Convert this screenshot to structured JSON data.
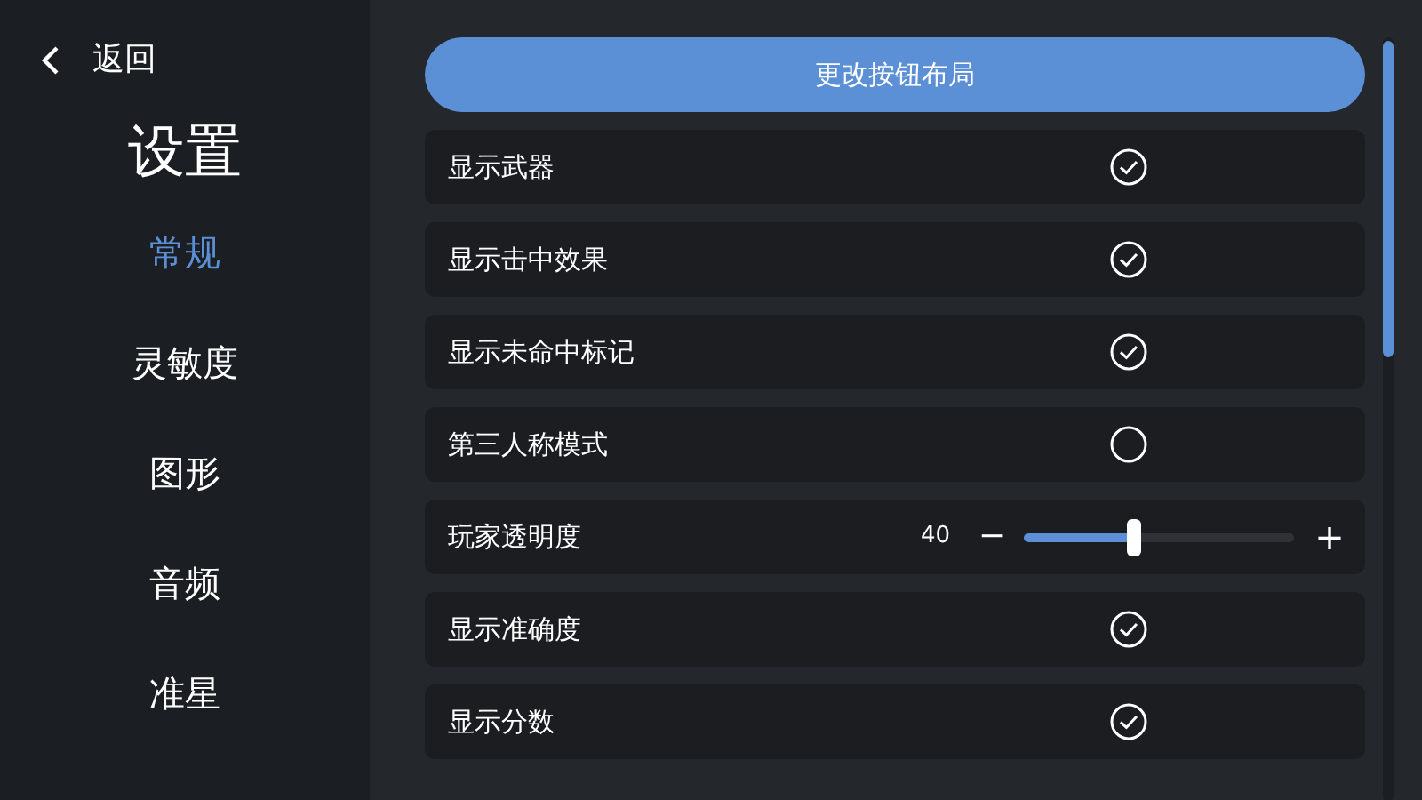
{
  "back": {
    "label": "返回"
  },
  "title": "设置",
  "sidebar": {
    "items": [
      {
        "label": "常规",
        "selected": true
      },
      {
        "label": "灵敏度",
        "selected": false
      },
      {
        "label": "图形",
        "selected": false
      },
      {
        "label": "音频",
        "selected": false
      },
      {
        "label": "准星",
        "selected": false
      }
    ]
  },
  "layout_button": "更改按钮布局",
  "settings": [
    {
      "kind": "checkbox",
      "label": "显示武器",
      "checked": true
    },
    {
      "kind": "checkbox",
      "label": "显示击中效果",
      "checked": true
    },
    {
      "kind": "checkbox",
      "label": "显示未命中标记",
      "checked": true
    },
    {
      "kind": "checkbox",
      "label": "第三人称模式",
      "checked": false
    },
    {
      "kind": "slider",
      "label": "玩家透明度",
      "reading": "40",
      "level": 0.41,
      "minus": "−",
      "plus": "+"
    },
    {
      "kind": "checkbox",
      "label": "显示准确度",
      "checked": true
    },
    {
      "kind": "checkbox",
      "label": "显示分数",
      "checked": true
    }
  ]
}
